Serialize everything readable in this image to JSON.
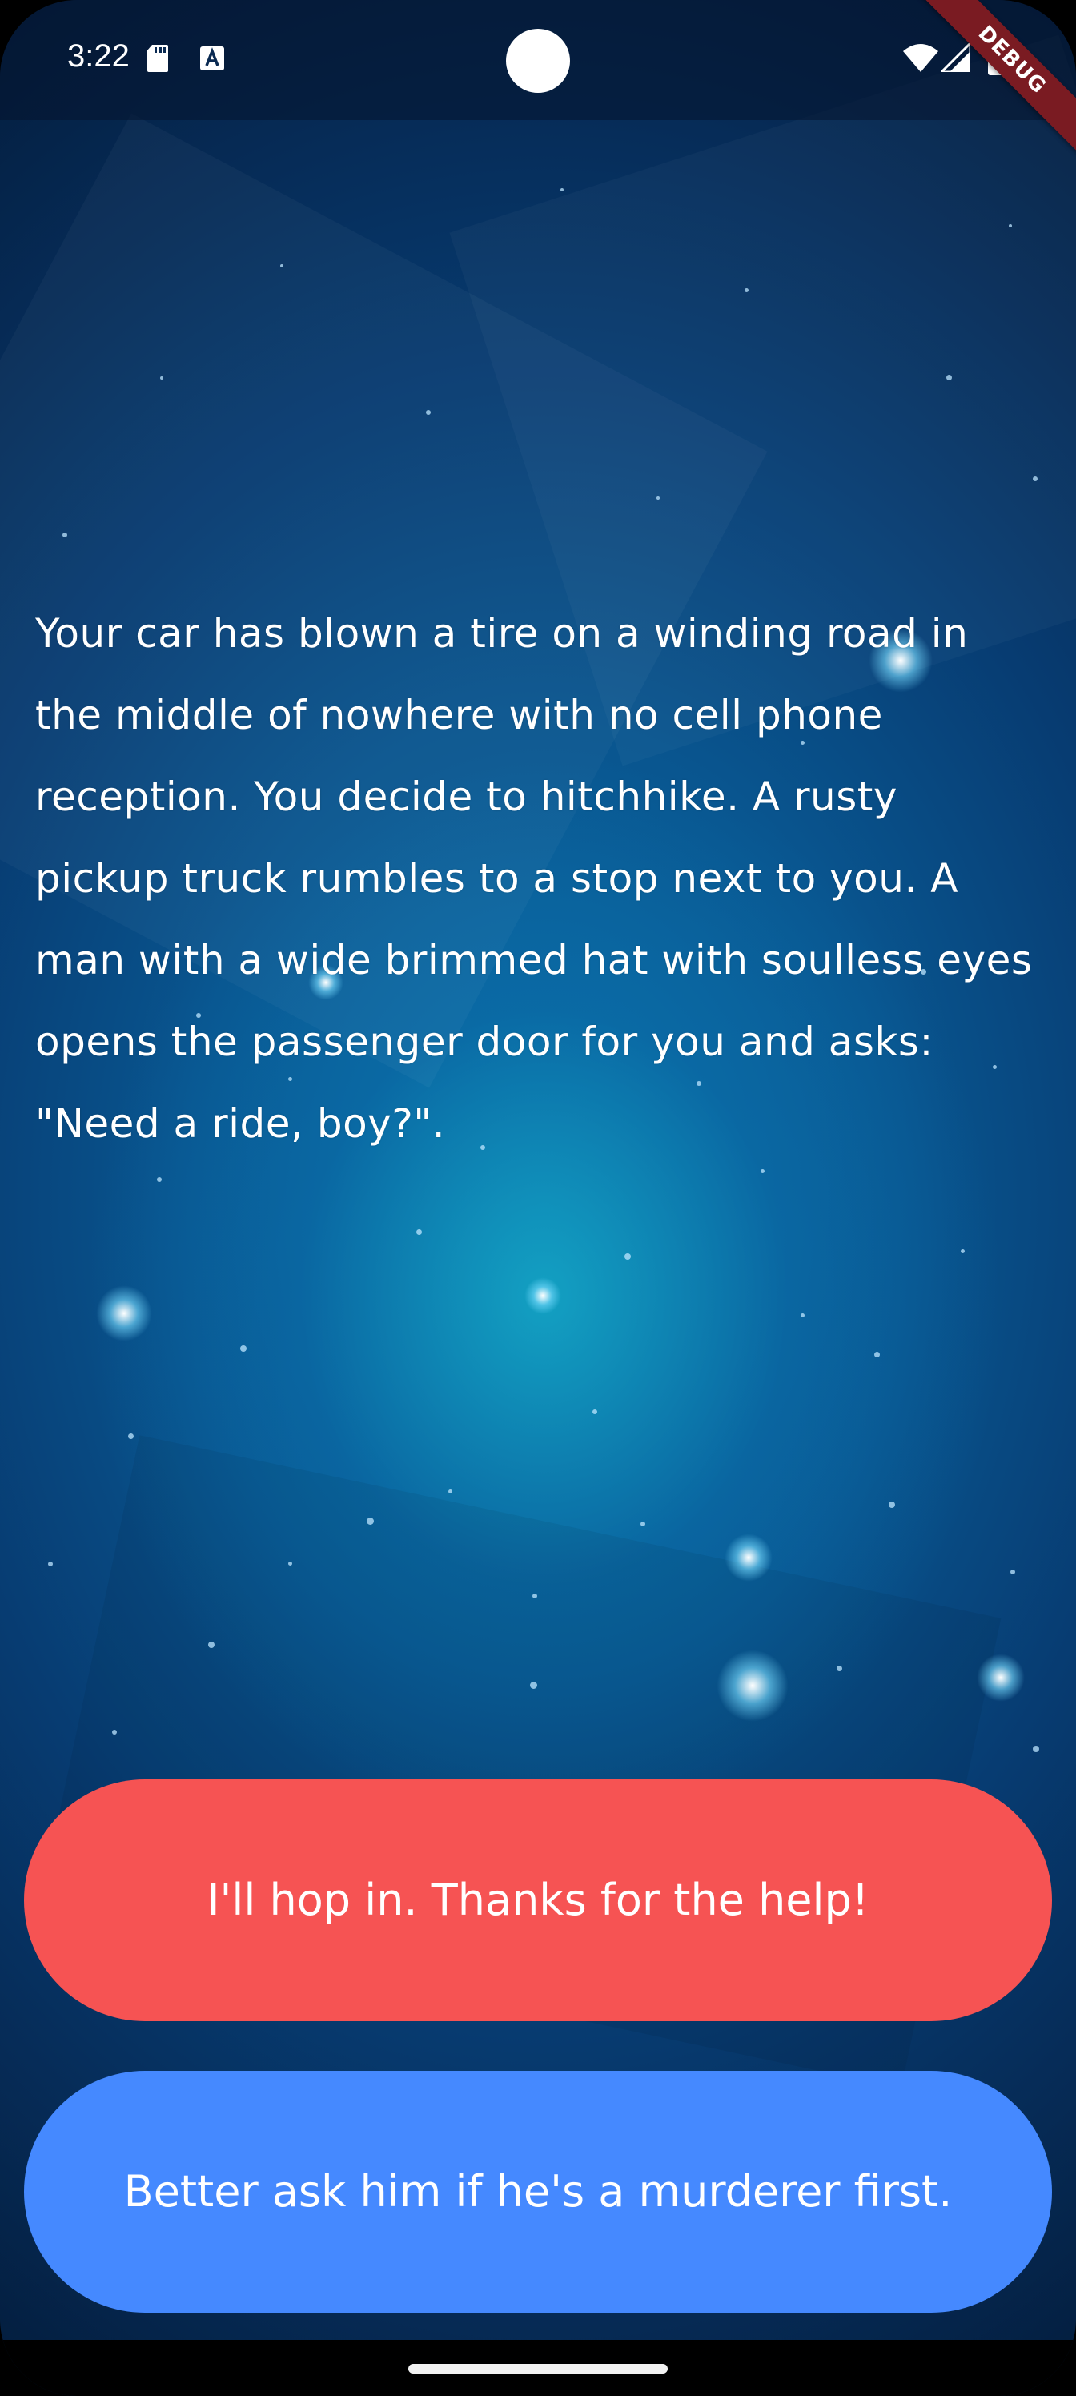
{
  "status_bar": {
    "time": "3:22",
    "icons": [
      "sd-card-icon",
      "a-notification-icon",
      "wifi-icon",
      "signal-icon",
      "battery-icon"
    ]
  },
  "debug_banner": {
    "label": "DEBUG",
    "color": "#7a1b22"
  },
  "story": {
    "text": "Your car has blown a tire on a winding road in the middle of nowhere with no cell phone reception. You decide to hitchhike. A rusty pickup truck rumbles to a stop next to you. A man with a wide brimmed hat with soulless eyes opens the passenger door for you and asks: \"Need a ride, boy?\"."
  },
  "choices": [
    {
      "label": "I'll hop in. Thanks for the help!",
      "color": "#f65353"
    },
    {
      "label": "Better ask him if he's a murderer first.",
      "color": "#4589ff"
    }
  ],
  "colors": {
    "background_top": "#041e3f",
    "background_center": "#0b6fa8",
    "text": "#ffffff"
  }
}
